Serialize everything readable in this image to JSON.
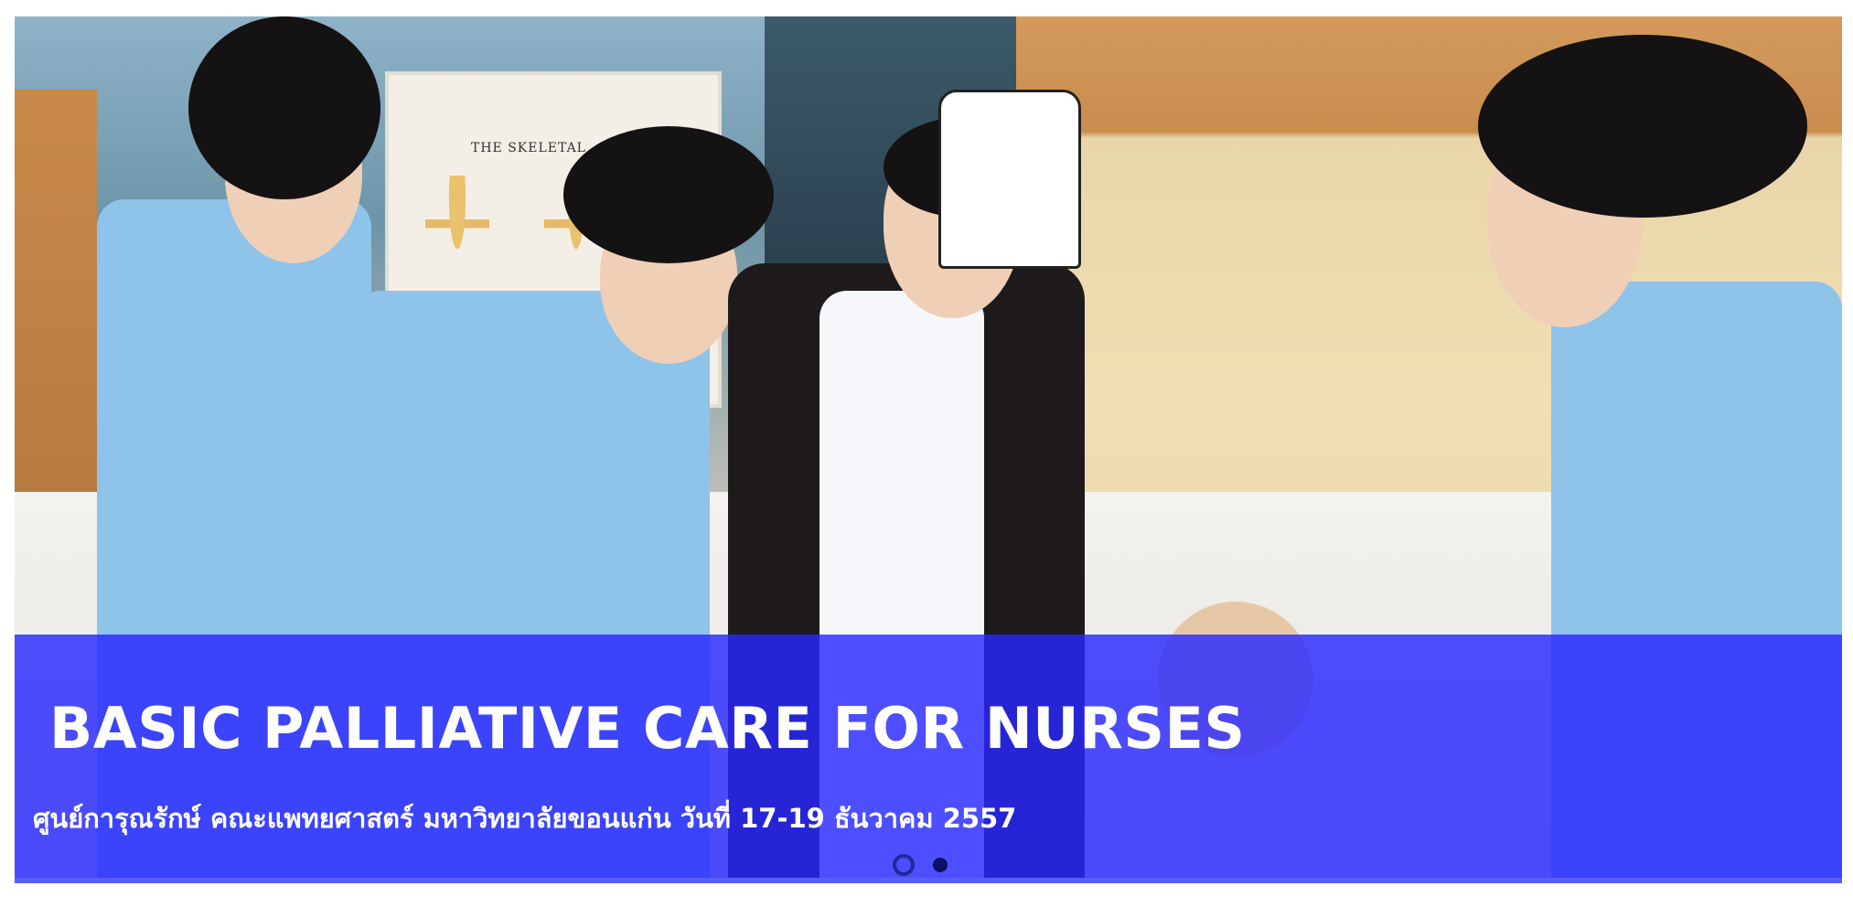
{
  "slide": {
    "title": "BASIC PALLIATIVE CARE FOR NURSES",
    "subtitle": "ศูนย์การุณรักษ์ คณะแพทยศาสตร์ มหาวิทยาลัยขอนแก่น วันที่ 17-19 ธันวาคม 2557",
    "poster_text": "THE SKELETAL",
    "overlay_color": "#2828ff",
    "image_description_icon": "photo-slide-image"
  },
  "pagination": {
    "total": 2,
    "active_index": 1
  }
}
